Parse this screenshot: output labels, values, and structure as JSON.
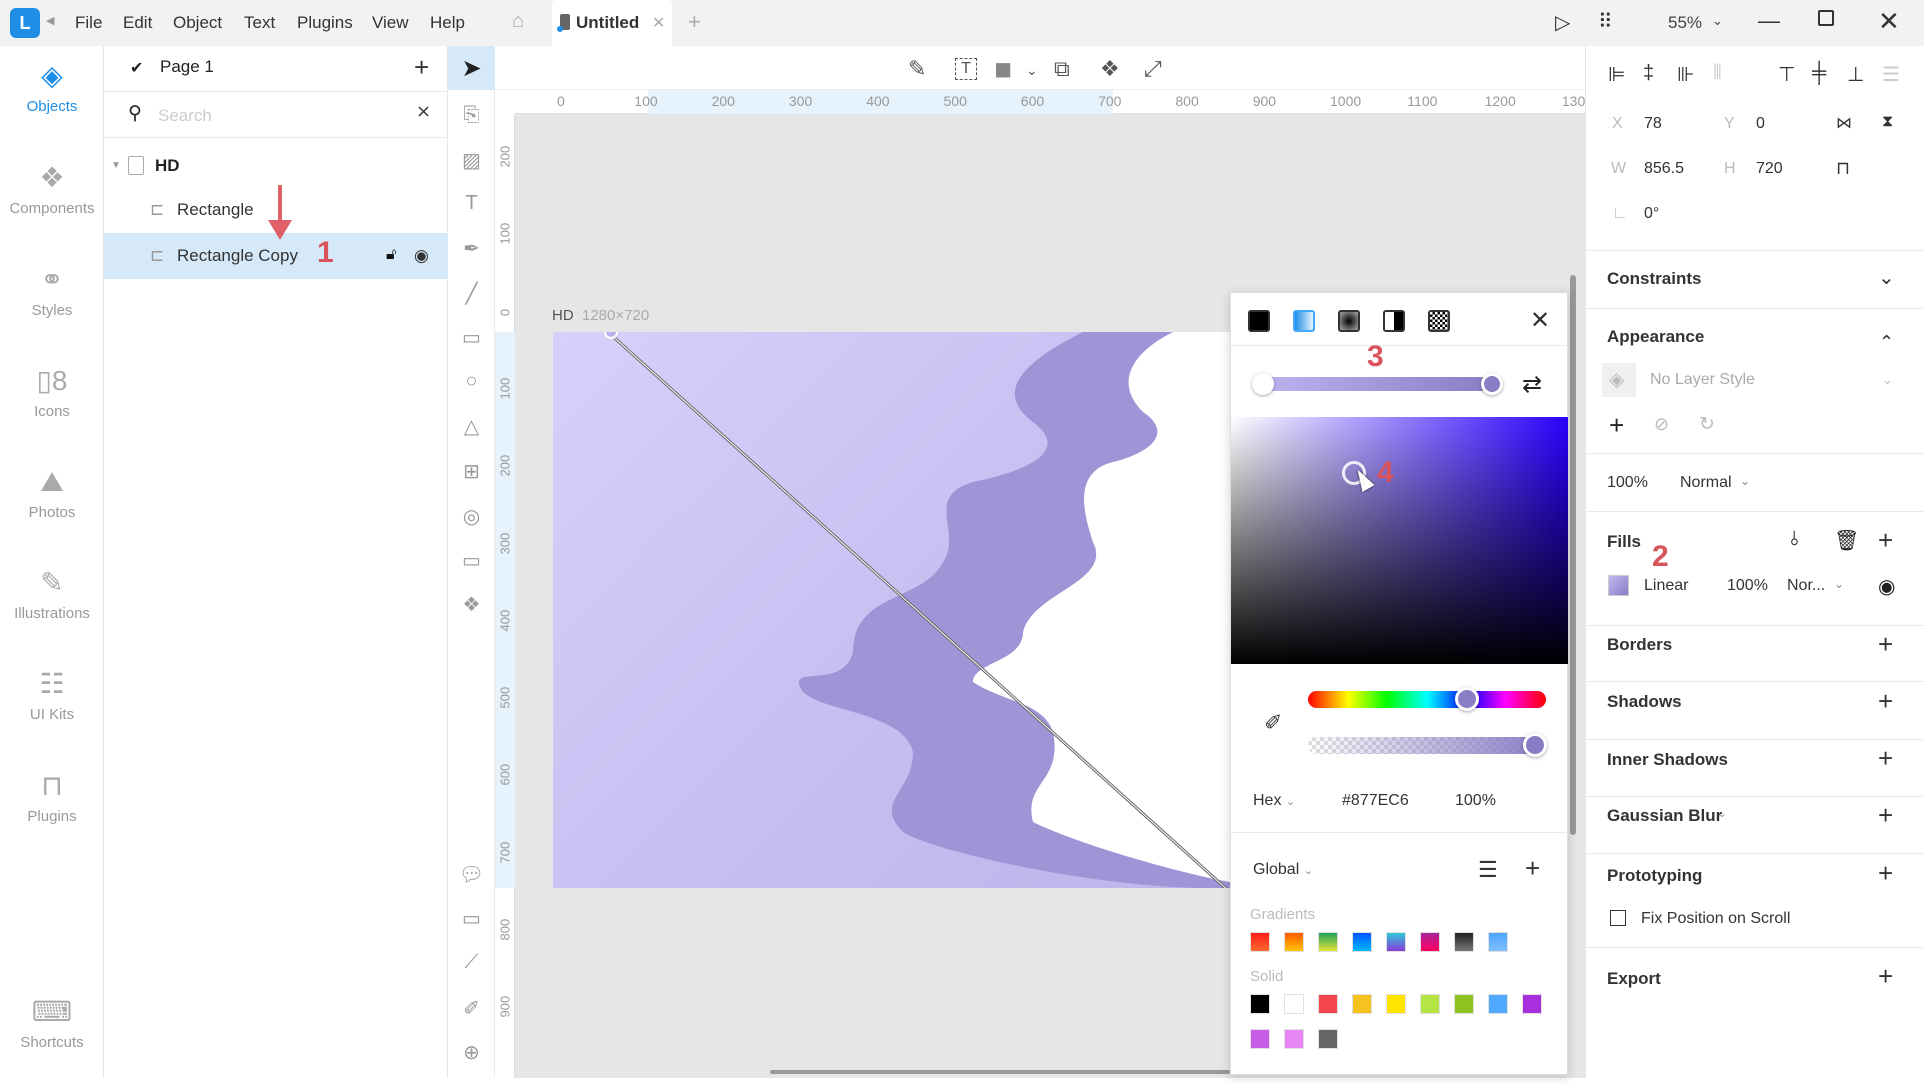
{
  "titlebar": {
    "menu": [
      "File",
      "Edit",
      "Object",
      "Text",
      "Plugins",
      "View",
      "Help"
    ],
    "tab_title": "Untitled",
    "zoom": "55%"
  },
  "leftnav": [
    {
      "label": "Objects",
      "icon": "layers-icon",
      "active": true
    },
    {
      "label": "Components",
      "icon": "components-icon"
    },
    {
      "label": "Styles",
      "icon": "styles-icon"
    },
    {
      "label": "Icons",
      "icon": "icons-icon"
    },
    {
      "label": "Photos",
      "icon": "photos-icon"
    },
    {
      "label": "Illustrations",
      "icon": "illustrations-icon"
    },
    {
      "label": "UI Kits",
      "icon": "ui-kits-icon"
    },
    {
      "label": "Plugins",
      "icon": "plugins-icon"
    },
    {
      "label": "Shortcuts",
      "icon": "keyboard-icon"
    }
  ],
  "layers": {
    "page": "Page 1",
    "search_placeholder": "Search",
    "artboard": "HD",
    "items": [
      {
        "name": "Rectangle",
        "selected": false
      },
      {
        "name": "Rectangle Copy",
        "selected": true
      }
    ]
  },
  "annotations": {
    "a1": "1",
    "a2": "2",
    "a3": "3",
    "a4": "4"
  },
  "canvas": {
    "artboard_name": "HD",
    "artboard_size": "1280×720",
    "hruler": [
      "0",
      "100",
      "200",
      "300",
      "400",
      "500",
      "600",
      "700",
      "800",
      "900",
      "1000",
      "1100",
      "1200",
      "130"
    ],
    "vruler": [
      "200",
      "100",
      "0",
      "100",
      "200",
      "300",
      "400",
      "500",
      "600",
      "700",
      "800",
      "900"
    ]
  },
  "properties": {
    "x_label": "X",
    "x": "78",
    "y_label": "Y",
    "y": "0",
    "w_label": "W",
    "w": "856.5",
    "h_label": "H",
    "h": "720",
    "rotation": "0°",
    "constraints": "Constraints",
    "appearance": "Appearance",
    "layer_style": "No Layer Style",
    "opacity": "100%",
    "blend": "Normal",
    "fills": "Fills",
    "fill": {
      "type": "Linear",
      "opacity": "100%",
      "blend": "Nor...",
      "color": "#a99fe0"
    },
    "borders": "Borders",
    "shadows": "Shadows",
    "inner_shadows": "Inner Shadows",
    "gaussian_blur": "Gaussian Blur",
    "prototyping": "Prototyping",
    "fix_position": "Fix Position on Scroll",
    "export": "Export"
  },
  "picker": {
    "fill_types": [
      "solid-fill",
      "linear-gradient",
      "radial-gradient",
      "angular-gradient",
      "pattern-fill"
    ],
    "selected_type": "linear-gradient",
    "gradient_start": "#bcb4ee",
    "gradient_end": "#877ec6",
    "mode": "Hex",
    "hex": "#877EC6",
    "alpha": "100%",
    "library": "Global",
    "gradients_label": "Gradients",
    "solid_label": "Solid",
    "gradients": [
      [
        "#ff1a1a",
        "#ff6a30"
      ],
      [
        "#ff5a00",
        "#ffc300"
      ],
      [
        "#1fa05a",
        "#e5e53a"
      ],
      [
        "#0055ff",
        "#00b7ff"
      ],
      [
        "#2ec9d8",
        "#8a3ad8"
      ],
      [
        "#a8249c",
        "#ff0060"
      ],
      [
        "#222222",
        "#777777"
      ],
      [
        "#4da3ff",
        "#7fc0ff"
      ]
    ],
    "solids": [
      "#000000",
      "#ffffff",
      "#f5454f",
      "#f5c222",
      "#ffe600",
      "#b5e545",
      "#8dc21f",
      "#4ea9ff",
      "#a930e0",
      "#c95ee6",
      "#e787f5",
      "#666666"
    ]
  }
}
